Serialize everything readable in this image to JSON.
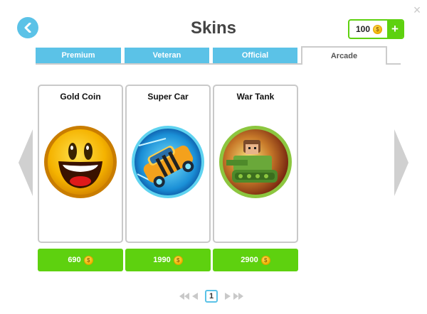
{
  "close_glyph": "×",
  "header": {
    "title": "Skins",
    "back_icon": "chevron-left-icon",
    "coins": "100",
    "add_glyph": "+"
  },
  "tabs": [
    {
      "label": "Premium",
      "active": false
    },
    {
      "label": "Veteran",
      "active": false
    },
    {
      "label": "Official",
      "active": false
    },
    {
      "label": "Arcade",
      "active": true
    }
  ],
  "skins": [
    {
      "name": "Gold Coin",
      "price": "690",
      "icon": "gold-coin-skin-icon"
    },
    {
      "name": "Super Car",
      "price": "1990",
      "icon": "super-car-skin-icon"
    },
    {
      "name": "War Tank",
      "price": "2900",
      "icon": "war-tank-skin-icon"
    }
  ],
  "pagination": {
    "page": "1"
  },
  "coin_glyph": "$",
  "colors": {
    "accent": "#5bc2e7",
    "buy": "#5ed10f",
    "coin": "#f2b600"
  }
}
